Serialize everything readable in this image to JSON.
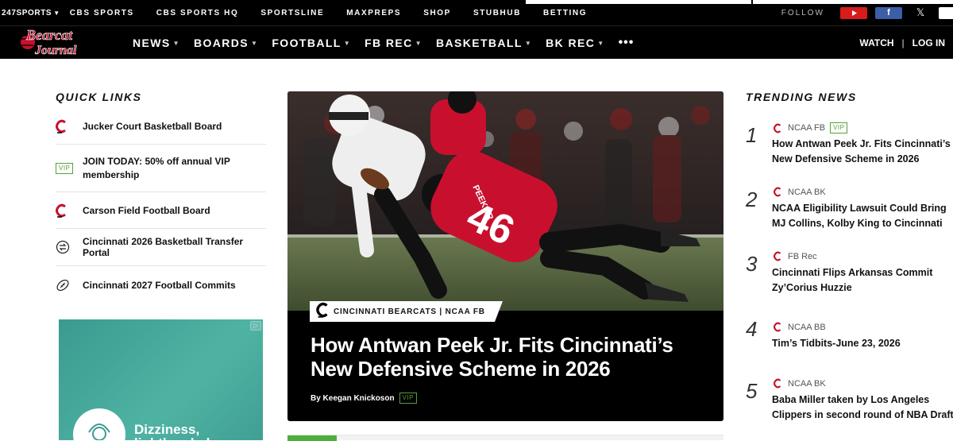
{
  "network_bar": {
    "links": [
      "247SPORTS",
      "CBS SPORTS",
      "CBS SPORTS HQ",
      "SPORTSLINE",
      "MAXPREPS",
      "SHOP",
      "STUBHUB",
      "BETTING"
    ],
    "follow_label": "FOLLOW",
    "social_icons": [
      "youtube-icon",
      "facebook-icon",
      "x-icon"
    ]
  },
  "site_nav": {
    "logo_text": "Bearcat Journal",
    "items": [
      "NEWS",
      "BOARDS",
      "FOOTBALL",
      "FB REC",
      "BASKETBALL",
      "BK REC"
    ],
    "more": "•••",
    "watch": "WATCH",
    "separator": "|",
    "login": "LOG IN"
  },
  "quick_links": {
    "title": "QUICK LINKS",
    "items": [
      {
        "icon": "cincinnati-c-icon",
        "label": "Jucker Court Basketball Board"
      },
      {
        "icon": "vip-badge",
        "badge": "VIP",
        "label": "JOIN TODAY: 50% off annual VIP membership"
      },
      {
        "icon": "cincinnati-c-icon",
        "label": "Carson Field Football Board"
      },
      {
        "icon": "transfer-portal-icon",
        "label": "Cincinnati 2026 Basketball Transfer Portal"
      },
      {
        "icon": "football-icon",
        "label": "Cincinnati 2027 Football Commits"
      }
    ]
  },
  "ad": {
    "text": "Dizziness, lightheadedness",
    "badge_icon": "ad-choices-icon"
  },
  "hero": {
    "tag": "CINCINNATI BEARCATS | NCAA FB",
    "headline": "How Antwan Peek Jr. Fits Cincinnati’s New Defensive Scheme in 2026",
    "byline": "By Keegan Knickoson",
    "badge": "VIP",
    "jersey_number": "46",
    "jersey_name": "PEEK JR"
  },
  "trending": {
    "title": "TRENDING NEWS",
    "items": [
      {
        "rank": "1",
        "category": "NCAA FB",
        "badge": "VIP",
        "title": "How Antwan Peek Jr. Fits Cincinnati’s New Defensive Scheme in 2026"
      },
      {
        "rank": "2",
        "category": "NCAA BK",
        "badge": "",
        "title": "NCAA Eligibility Lawsuit Could Bring MJ Collins, Kolby King to Cincinnati"
      },
      {
        "rank": "3",
        "category": "FB Rec",
        "badge": "",
        "title": "Cincinnati Flips Arkansas Commit Zy’Corius Huzzie"
      },
      {
        "rank": "4",
        "category": "NCAA BB",
        "badge": "",
        "title": "Tim’s Tidbits-June 23, 2026"
      },
      {
        "rank": "5",
        "category": "NCAA BK",
        "badge": "",
        "title": "Baba Miller taken by Los Angeles Clippers in second round of NBA Draft"
      }
    ]
  },
  "colors": {
    "nav_bg": "#000000",
    "brand_red": "#c8102e",
    "vip_green": "#5a9d3a",
    "youtube_red": "#d81b1b",
    "facebook_blue": "#3b5ea7"
  }
}
